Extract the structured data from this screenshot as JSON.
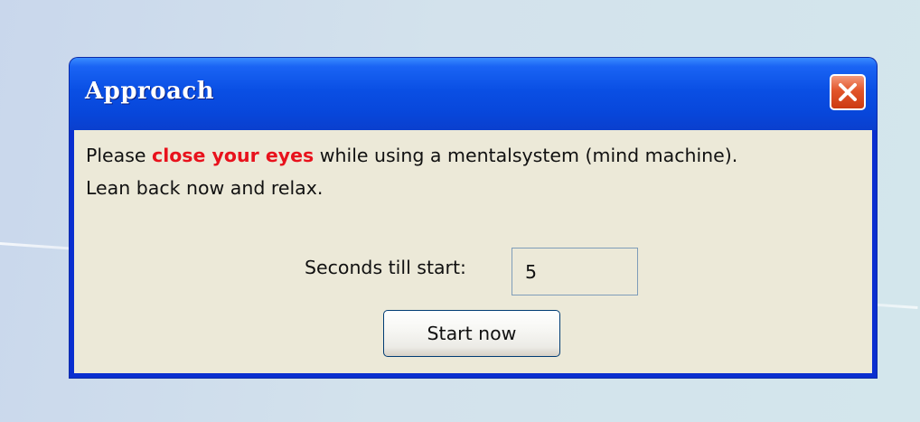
{
  "window": {
    "title": "Approach"
  },
  "message": {
    "line1_before": "Please ",
    "line1_emphasis": "close your eyes",
    "line1_after": " while using a mentalsystem (mind machine).",
    "line2": "Lean back now and relax."
  },
  "countdown": {
    "label": "Seconds till start:",
    "value": "5"
  },
  "buttons": {
    "start_now": "Start now"
  },
  "icons": {
    "close": "close-icon"
  },
  "colors": {
    "titlebar_blue": "#0a4fe4",
    "emphasis_red": "#e8121c",
    "client_background": "#ece9d8",
    "close_button_red": "#e2552a"
  }
}
